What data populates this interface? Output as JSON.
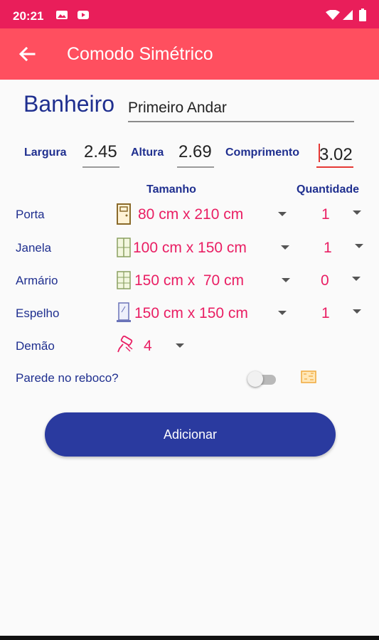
{
  "status_bar": {
    "time": "20:21"
  },
  "app_bar": {
    "title": "Comodo Simétrico"
  },
  "room": {
    "name": "Banheiro",
    "floor_value": "Primeiro Andar"
  },
  "dimensions": {
    "largura_label": "Largura",
    "largura_value": "2.45",
    "altura_label": "Altura",
    "altura_value": "2.69",
    "comprimento_label": "Comprimento",
    "comprimento_value": "3.02"
  },
  "columns": {
    "size": "Tamanho",
    "quantity": "Quantidade"
  },
  "items": [
    {
      "label": "Porta",
      "size": "80 cm x 210 cm",
      "quantity": "1",
      "icon": "door-icon"
    },
    {
      "label": "Janela",
      "size": "100 cm x 150 cm",
      "quantity": "1",
      "icon": "window-icon"
    },
    {
      "label": "Armário",
      "size": "150 cm x  70 cm",
      "quantity": "0",
      "icon": "cabinet-icon"
    },
    {
      "label": "Espelho",
      "size": "150 cm x 150 cm",
      "quantity": "1",
      "icon": "mirror-icon"
    }
  ],
  "coats": {
    "label": "Demão",
    "value": "4",
    "icon": "paint-roller-icon"
  },
  "plaster": {
    "label": "Parede no reboco?",
    "toggle_on": false,
    "icon": "wall-texture-icon"
  },
  "actions": {
    "add_label": "Adicionar"
  },
  "colors": {
    "status_bar": "#e91e5a",
    "app_bar": "#ff4f5f",
    "primary": "#2a3a9f",
    "accent": "#e91e63",
    "label": "#1f2f8f"
  }
}
